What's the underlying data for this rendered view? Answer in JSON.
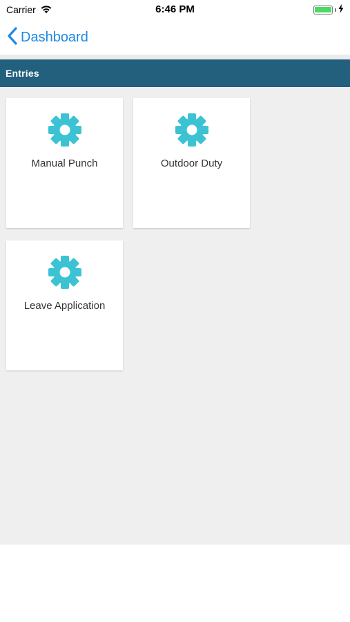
{
  "status_bar": {
    "carrier": "Carrier",
    "time": "6:46 PM",
    "battery_level": 1.0,
    "battery_color": "#4cd964"
  },
  "nav": {
    "back_label": "Dashboard",
    "back_icon": "chevron-left-icon",
    "accent_color": "#1e88e5"
  },
  "section": {
    "title": "Entries",
    "header_color": "#23607e"
  },
  "tiles": [
    {
      "label": "Manual Punch",
      "icon": "gear-icon"
    },
    {
      "label": "Outdoor Duty",
      "icon": "gear-icon"
    },
    {
      "label": "Leave Application",
      "icon": "gear-icon"
    }
  ],
  "icon_color": "#3cc3d3"
}
